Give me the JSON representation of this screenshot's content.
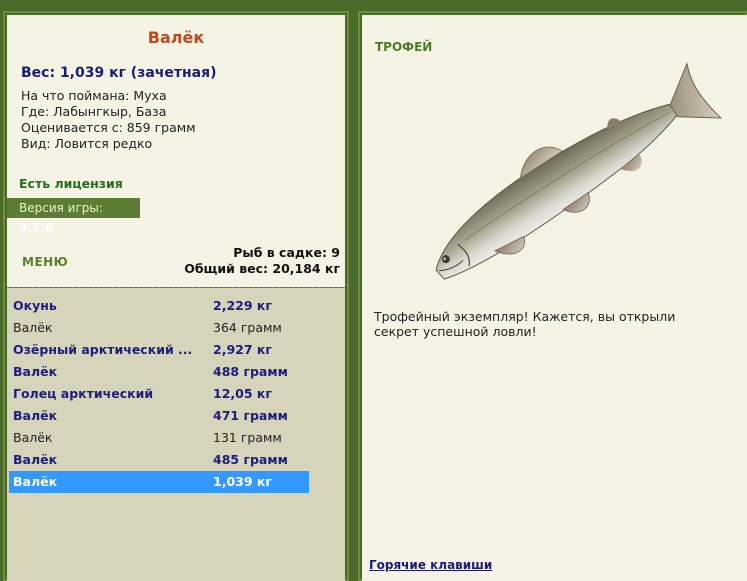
{
  "fish_card": {
    "name": "Валёк",
    "weight": "Вес: 1,039 кг (зачетная)",
    "caught_on": "На что поймана: Муха",
    "where": "Где: Лабынгкыр, База",
    "value": "Оценивается с: 859 грамм",
    "rarity": "Вид: Ловится редко"
  },
  "license": "Есть лицензия",
  "version": {
    "label": "Версия игры:",
    "value": "3.7.6"
  },
  "menu_label": "МЕНЮ",
  "keepnet": {
    "count": "Рыб в садке: 9",
    "total": "Общий вес: 20,184 кг"
  },
  "catch_list": [
    {
      "name": "Окунь",
      "weight": "2,229 кг",
      "style": "bold"
    },
    {
      "name": "Валёк",
      "weight": "364 грамм",
      "style": "plain"
    },
    {
      "name": "Озёрный арктический ...",
      "weight": "2,927 кг",
      "style": "bold"
    },
    {
      "name": "Валёк",
      "weight": "488 грамм",
      "style": "bold"
    },
    {
      "name": "Голец арктический",
      "weight": "12,05 кг",
      "style": "bold"
    },
    {
      "name": "Валёк",
      "weight": "471 грамм",
      "style": "bold"
    },
    {
      "name": "Валёк",
      "weight": "131 грамм",
      "style": "plain"
    },
    {
      "name": "Валёк",
      "weight": "485 грамм",
      "style": "bold"
    },
    {
      "name": "Валёк",
      "weight": "1,039 кг",
      "style": "selected"
    }
  ],
  "trophy": {
    "heading": "ТРОФЕЙ",
    "text": "Трофейный экземпляр! Кажется, вы открыли секрет успешной ловли!"
  },
  "hotkeys_link": "Горячие клавиши",
  "colors": {
    "frame_green": "#4a6a2b",
    "title_orange": "#c0481e",
    "selection_blue": "#3399ff",
    "text_navy": "#1b1b78"
  }
}
